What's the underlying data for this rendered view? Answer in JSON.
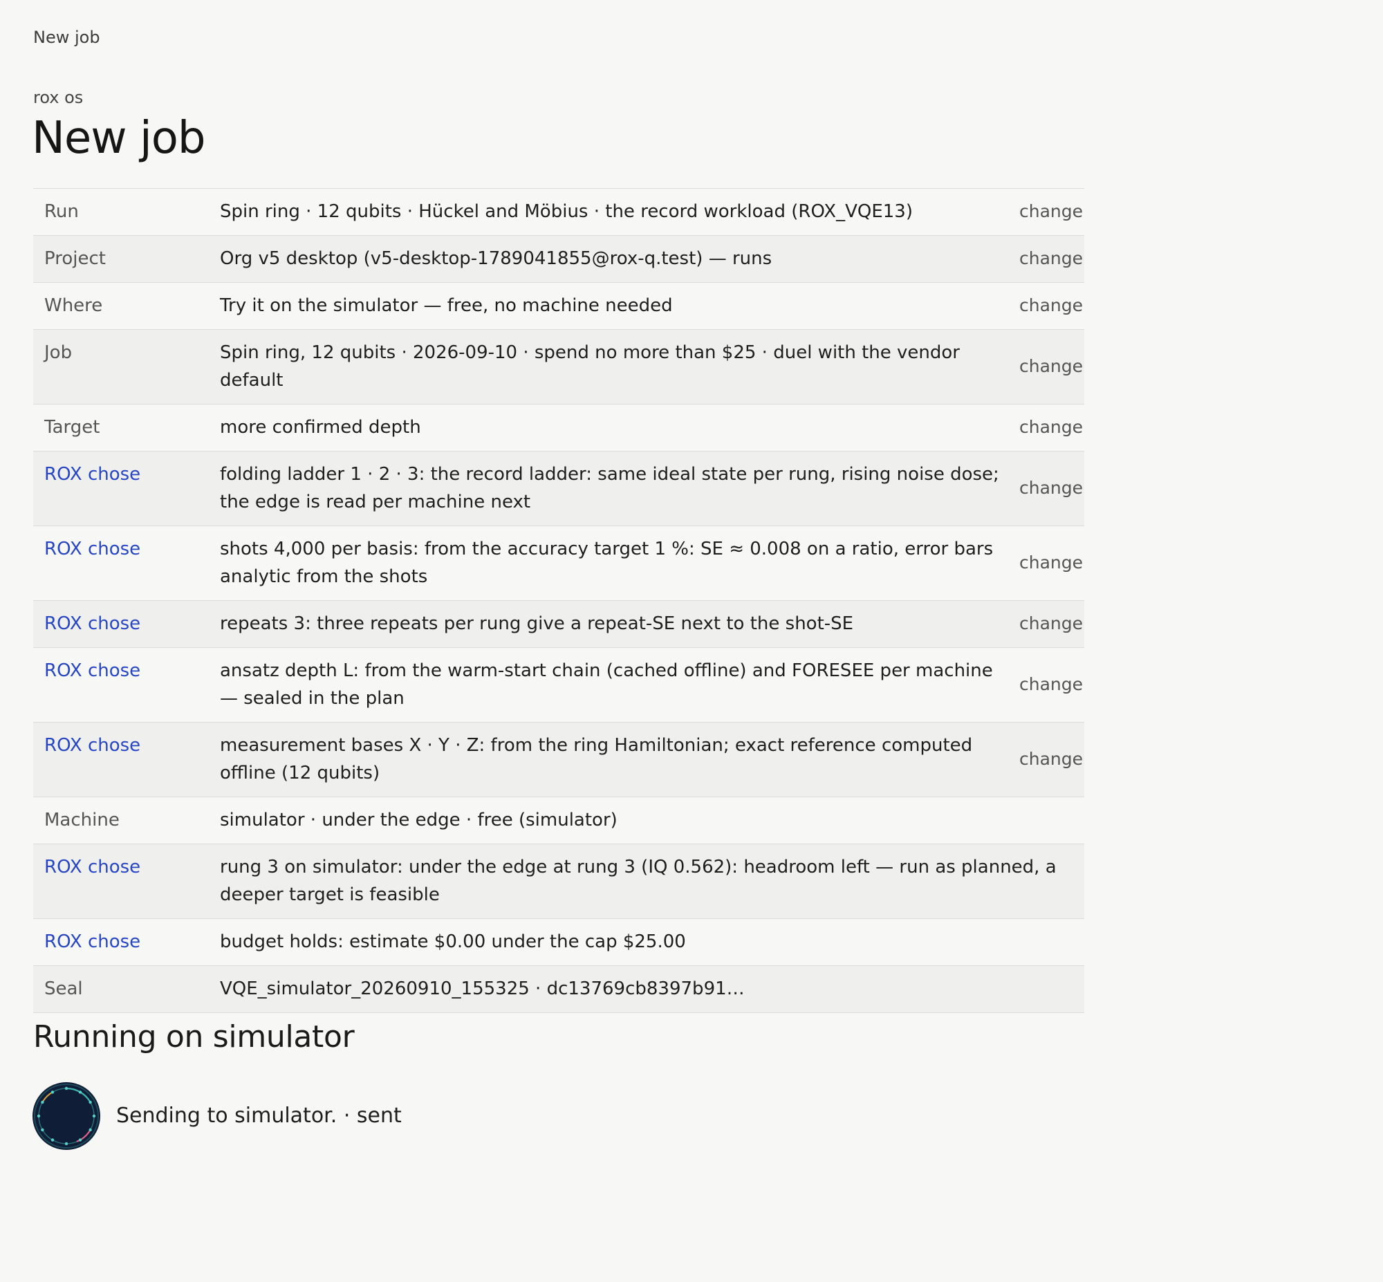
{
  "breadcrumb": "New job",
  "org": "rox os",
  "title": "New job",
  "rows": [
    {
      "label": "Run",
      "value": "Spin ring · 12 qubits · Hückel and Möbius · the record workload (ROX_VQE13)",
      "action": "change"
    },
    {
      "label": "Project",
      "value": "Org v5 desktop (v5-desktop-1789041855@rox-q.test) — runs",
      "action": "change"
    },
    {
      "label": "Where",
      "value": "Try it on the simulator — free, no machine needed",
      "action": "change"
    },
    {
      "label": "Job",
      "value": "Spin ring, 12 qubits · 2026-09-10 · spend no more than $25 · duel with the vendor default",
      "action": "change"
    },
    {
      "label": "Target",
      "value": "more confirmed depth",
      "action": "change"
    },
    {
      "label": "ROX chose",
      "value": "folding ladder 1 · 2 · 3: the record ladder: same ideal state per rung, rising noise dose; the edge is read per machine next",
      "action": "change"
    },
    {
      "label": "ROX chose",
      "value": "shots 4,000 per basis: from the accuracy target 1 %: SE ≈ 0.008 on a ratio, error bars analytic from the shots",
      "action": "change"
    },
    {
      "label": "ROX chose",
      "value": "repeats 3: three repeats per rung give a repeat-SE next to the shot-SE",
      "action": "change"
    },
    {
      "label": "ROX chose",
      "value": "ansatz depth L: from the warm-start chain (cached offline) and FORESEE per machine — sealed in the plan",
      "action": "change"
    },
    {
      "label": "ROX chose",
      "value": "measurement bases X · Y · Z: from the ring Hamiltonian; exact reference computed offline (12 qubits)",
      "action": "change"
    },
    {
      "label": "Machine",
      "value": "simulator · under the edge · free (simulator)",
      "action": ""
    },
    {
      "label": "ROX chose",
      "value": "rung 3 on simulator: under the edge at rung 3 (IQ 0.562): headroom left — run as planned, a deeper target is feasible",
      "action": ""
    },
    {
      "label": "ROX chose",
      "value": "budget holds: estimate $0.00 under the cap $25.00",
      "action": ""
    },
    {
      "label": "Seal",
      "value": "VQE_simulator_20260910_155325 · dc13769cb8397b91…",
      "action": ""
    }
  ],
  "running": {
    "heading": "Running on simulator",
    "status": "Sending to simulator. · sent"
  }
}
